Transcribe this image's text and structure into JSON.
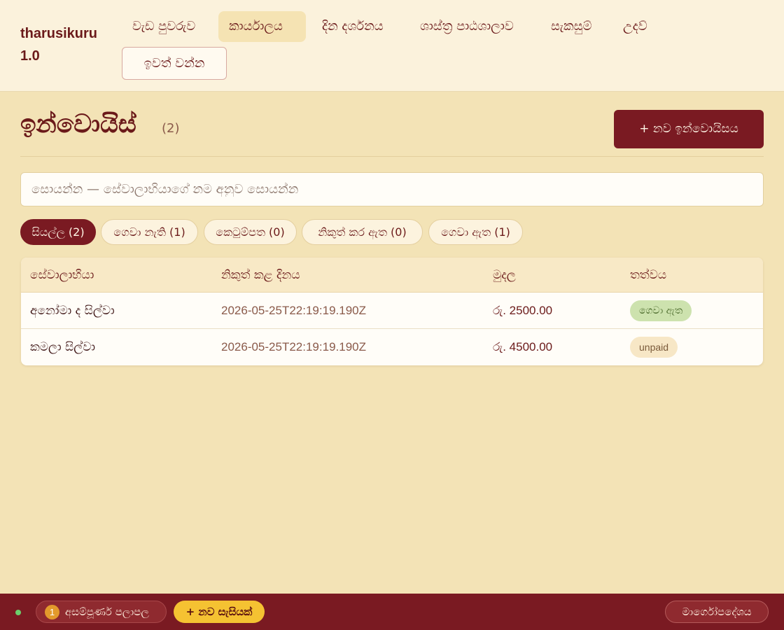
{
  "app": {
    "brand": "tharusikuru 1.0"
  },
  "nav": {
    "items": [
      {
        "label": "වැඩ පුවරුව",
        "active": false
      },
      {
        "label": "කාර්යාලය",
        "active": true
      },
      {
        "label": "දින දර්ශනය",
        "active": false
      },
      {
        "label": "ශාස්ත්‍ර පාඨශාලාව",
        "active": false
      },
      {
        "label": "සැකසුම්",
        "active": false
      },
      {
        "label": "උදව්",
        "active": false
      }
    ],
    "logout_label": "ඉවත් වන්න"
  },
  "page": {
    "title": "ඉන්වොයිස්",
    "count": "(2)",
    "new_button_label": "+ නව ඉන්වොයිසය"
  },
  "search": {
    "placeholder": "සොයන්න — සේවාලාභියාගේ නම අනුව සොයන්න",
    "value": ""
  },
  "filters": [
    {
      "label": "සියල්ල (2)",
      "active": true
    },
    {
      "label": "ගෙවා නැති (1)",
      "active": false
    },
    {
      "label": "කෙටුම්පත (0)",
      "active": false
    },
    {
      "label": "නිකුත් කර ඇත (0)",
      "active": false
    },
    {
      "label": "ගෙවා ඇත (1)",
      "active": false
    }
  ],
  "table": {
    "headers": {
      "client": "සේවාලාභියා",
      "issued": "නිකුත් කළ දිනය",
      "amount": "මුදල",
      "status": "තත්වය"
    },
    "rows": [
      {
        "client": "අනෝමා ද සිල්වා",
        "issued": "2026-05-25T22:19:19.190Z",
        "amount": "රු. 2500.00",
        "status": "ගෙවා ඇත",
        "status_type": "paid"
      },
      {
        "client": "කමලා සිල්වා",
        "issued": "2026-05-25T22:19:19.190Z",
        "amount": "රු. 4500.00",
        "status": "unpaid",
        "status_type": "unpaid"
      }
    ]
  },
  "bottom_bar": {
    "pending_count": "1",
    "pending_label": "අසම්පූර්ණ පලාපල",
    "new_session_label": "+ නව සැසියක්",
    "guide_label": "මාර්ගෝපදේශය"
  },
  "colors": {
    "accent": "#7a1a22",
    "background": "#f3e3b6",
    "header_bg": "#fbf2dc",
    "paid_badge": "#cde2ae",
    "new_session": "#f5c232"
  }
}
